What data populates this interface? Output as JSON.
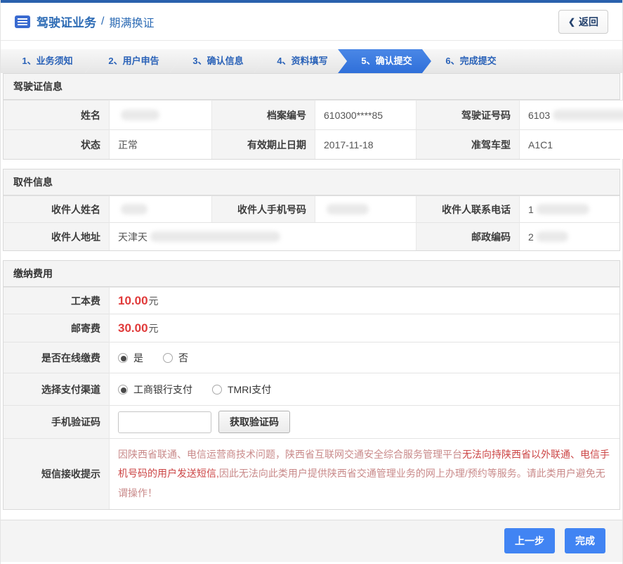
{
  "header": {
    "title": "驾驶证业务",
    "separator": "/",
    "subtitle": "期满换证",
    "back_label": "返回"
  },
  "icons": {
    "back_chevron": "❮",
    "doc_icon": "list-document-icon"
  },
  "steps": [
    {
      "label": "1、业务须知",
      "active": false
    },
    {
      "label": "2、用户申告",
      "active": false
    },
    {
      "label": "3、确认信息",
      "active": false
    },
    {
      "label": "4、资料填写",
      "active": false
    },
    {
      "label": "5、确认提交",
      "active": true
    },
    {
      "label": "6、完成提交",
      "active": false
    }
  ],
  "license": {
    "title": "驾驶证信息",
    "rows": [
      {
        "cells": [
          {
            "label": "姓名",
            "value": "",
            "redacted": true
          },
          {
            "label": "档案编号",
            "value": "610300****85",
            "redacted": false
          },
          {
            "label": "驾驶证号码",
            "value": "6103",
            "redacted": true
          }
        ]
      },
      {
        "cells": [
          {
            "label": "状态",
            "value": "正常",
            "redacted": false
          },
          {
            "label": "有效期止日期",
            "value": "2017-11-18",
            "redacted": false
          },
          {
            "label": "准驾车型",
            "value": "A1C1",
            "redacted": false
          }
        ]
      }
    ]
  },
  "pickup": {
    "title": "取件信息",
    "row1": {
      "cells": [
        {
          "label": "收件人姓名",
          "value": "",
          "redacted": true
        },
        {
          "label": "收件人手机号码",
          "value": "",
          "redacted": true
        },
        {
          "label": "收件人联系电话",
          "value": "1",
          "redacted": true
        }
      ]
    },
    "row2": {
      "address_label": "收件人地址",
      "address_value": "天津天",
      "postal_label": "邮政编码",
      "postal_value": "2"
    }
  },
  "payment": {
    "title": "缴纳费用",
    "fees": [
      {
        "label": "工本费",
        "amount": "10.00",
        "unit": "元"
      },
      {
        "label": "邮寄费",
        "amount": "30.00",
        "unit": "元"
      }
    ],
    "online_pay": {
      "label": "是否在线缴费",
      "options": [
        {
          "label": "是",
          "checked": true
        },
        {
          "label": "否",
          "checked": false
        }
      ]
    },
    "channel": {
      "label": "选择支付渠道",
      "options": [
        {
          "label": "工商银行支付",
          "checked": true
        },
        {
          "label": "TMRI支付",
          "checked": false
        }
      ]
    },
    "captcha": {
      "label": "手机验证码",
      "input_value": "",
      "input_placeholder": "",
      "button_label": "获取验证码"
    },
    "notice": {
      "label": "短信接收提示",
      "text_light_1": "因陕西省联通、电信运营商技术问题，陕西省互联网交通安全综合服务管理平台",
      "text_dark": "无法向持陕西省以外联通、电信手机号码的用户发送短信,",
      "text_light_2": "因此无法向此类用户提供陕西省交通管理业务的网上办理/预约等服务。请此类用户避免无谓操作！"
    }
  },
  "footer": {
    "prev_label": "上一步",
    "finish_label": "完成"
  },
  "colors": {
    "top_accent": "#2a61ad",
    "title_blue": "#2e6cb5",
    "active_step_blue": "#3b7de2",
    "button_blue": "#4184f3",
    "fee_red": "#e03a3a",
    "notice_light_red": "#c98a8a",
    "notice_dark_red": "#cc4646"
  }
}
